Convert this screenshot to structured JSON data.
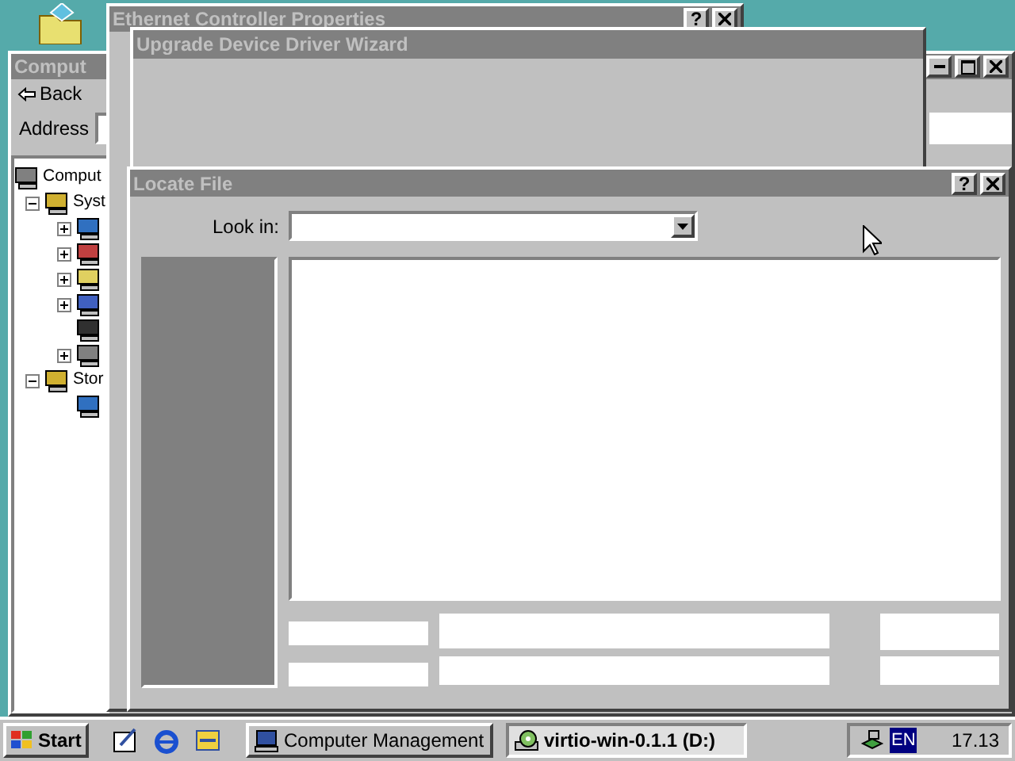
{
  "computer_management": {
    "title": "Comput",
    "active": false,
    "back_button": "Back",
    "address_label": "Address",
    "tree": [
      {
        "label": "Comput",
        "children": [
          {
            "label": "Syst",
            "expanded": true,
            "children": [
              {
                "kind": "expandable",
                "expanded": false
              },
              {
                "kind": "expandable",
                "expanded": false
              },
              {
                "kind": "expandable",
                "expanded": false
              },
              {
                "kind": "expandable",
                "expanded": false
              },
              {
                "kind": "leaf"
              },
              {
                "kind": "expandable",
                "expanded": false
              }
            ]
          },
          {
            "label": "Stor",
            "expanded": true,
            "children": [
              {
                "kind": "leaf"
              }
            ]
          }
        ]
      }
    ]
  },
  "ethernet_properties": {
    "title": "Ethernet Controller Properties",
    "active": false,
    "help_button": "?"
  },
  "wizard": {
    "title": "Upgrade Device Driver Wizard",
    "active": false
  },
  "locate_file": {
    "title": "Locate File",
    "active": false,
    "help_button": "?",
    "look_in_label": "Look in:"
  },
  "taskbar": {
    "start": "Start",
    "buttons": [
      {
        "label": "Computer Management",
        "selected": false
      },
      {
        "label": "virtio-win-0.1.1 (D:)",
        "selected": true
      }
    ],
    "language": "EN",
    "clock": "17.13"
  }
}
